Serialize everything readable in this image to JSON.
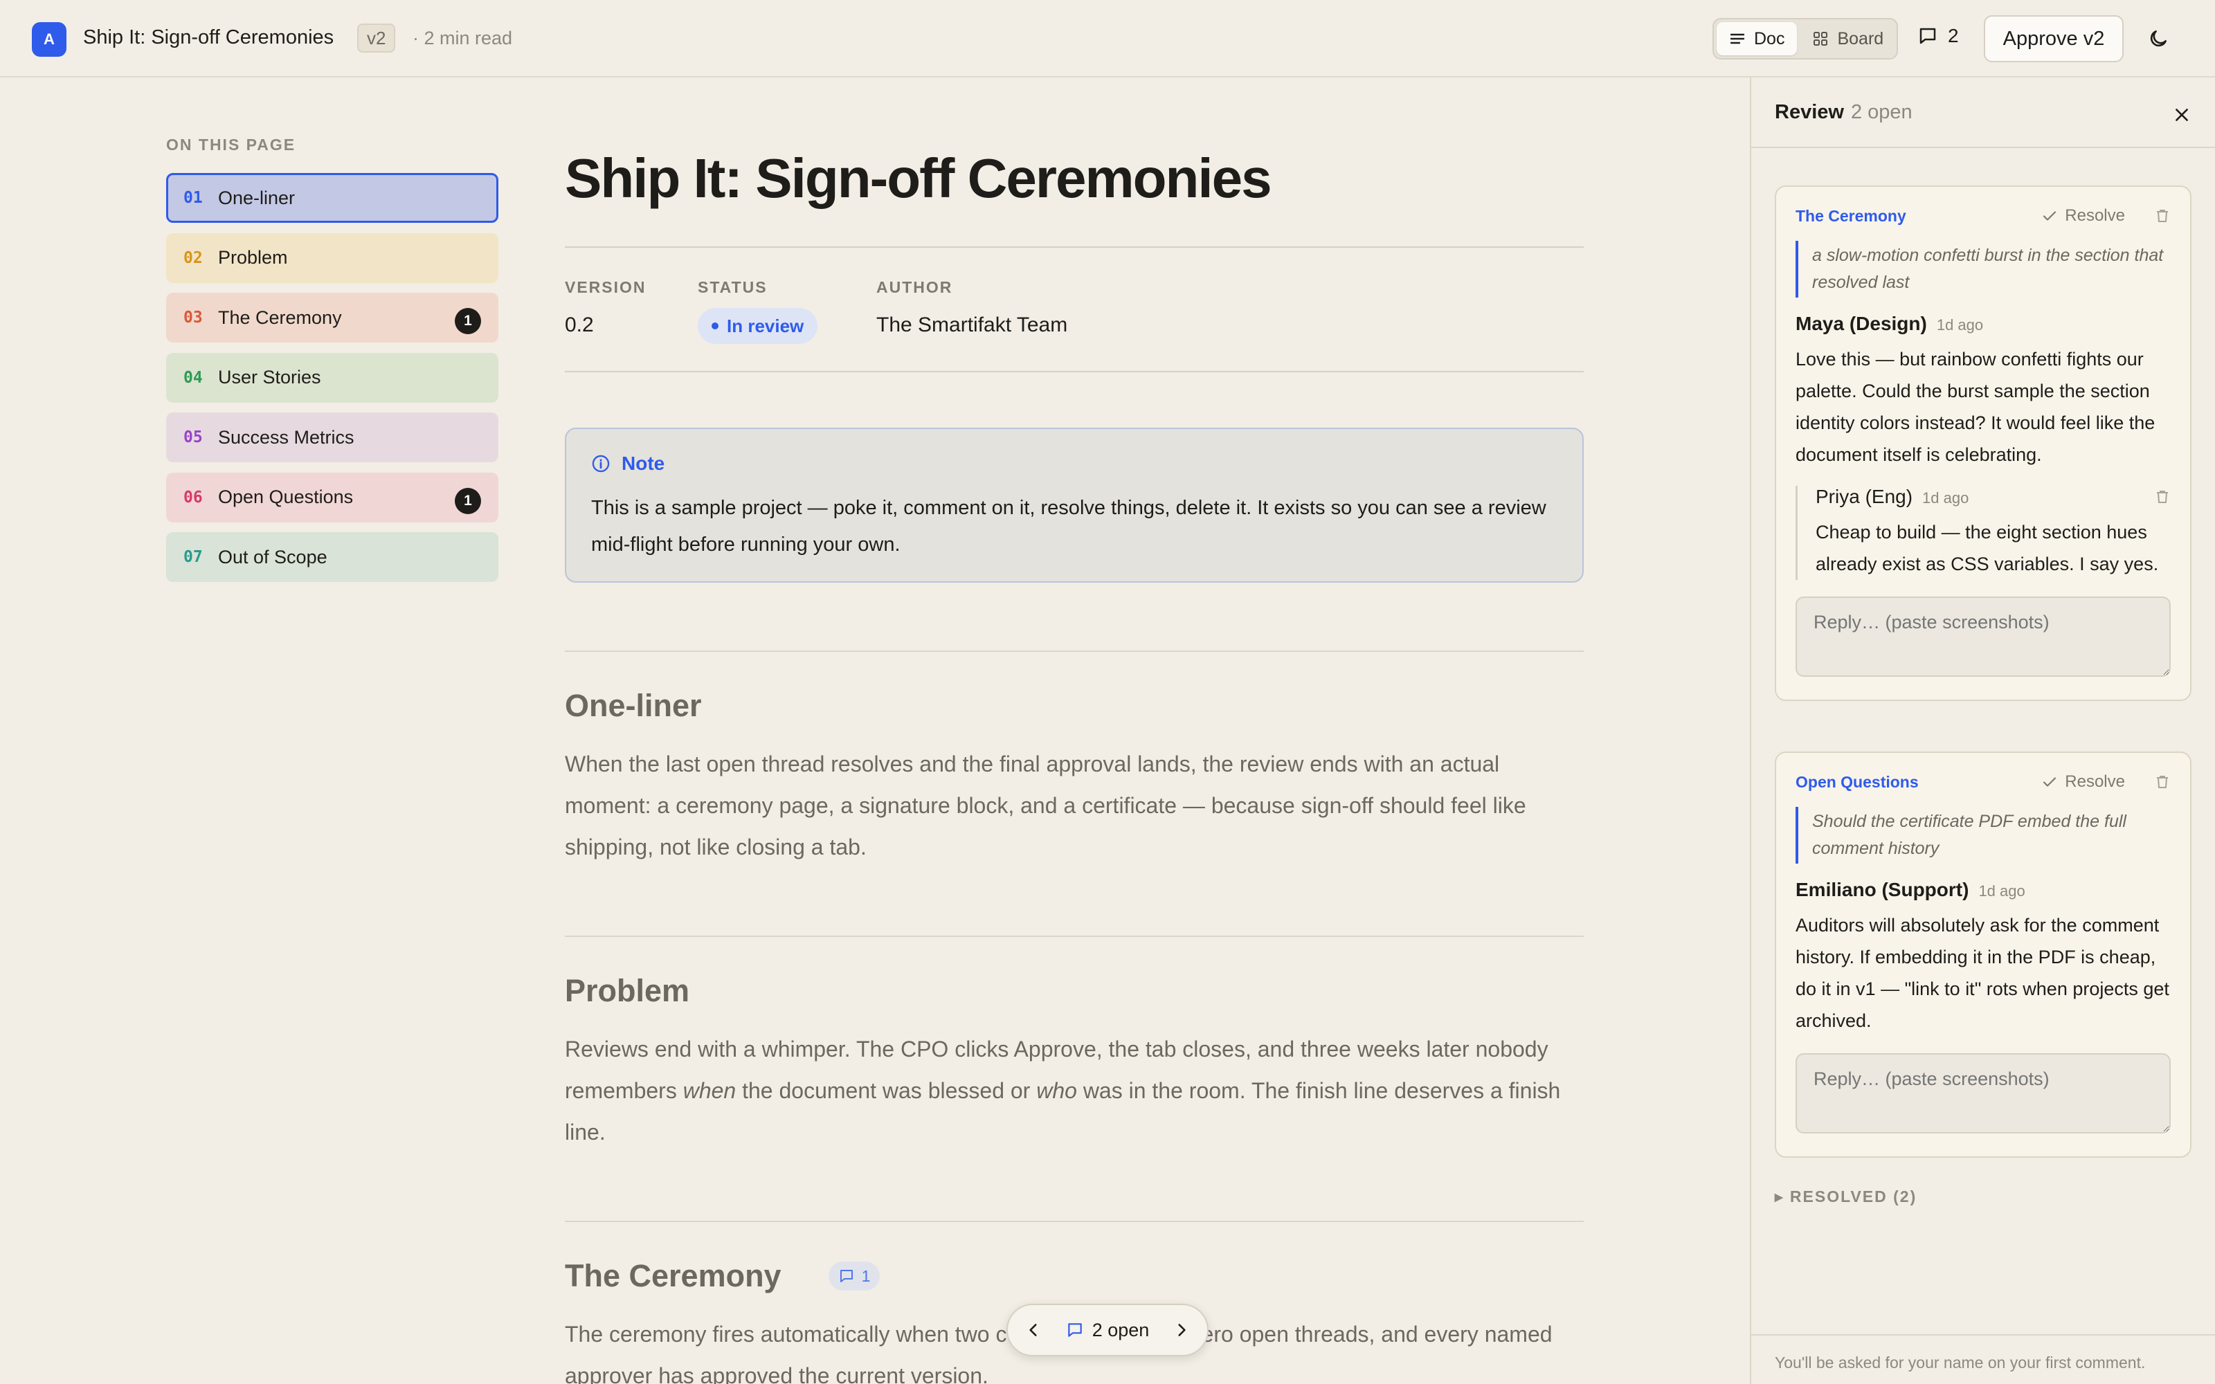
{
  "header": {
    "logo_letter": "A",
    "title": "Ship It: Sign-off Ceremonies",
    "version_badge": "v2",
    "read_time": "· 2 min read",
    "view_doc": "Doc",
    "view_board": "Board",
    "comments_count": "2",
    "approve_label": "Approve v2"
  },
  "toc": {
    "heading": "ON THIS PAGE",
    "items": [
      {
        "num": "01",
        "label": "One-liner",
        "badge": "",
        "color": "#2f5bea",
        "bg": "#c3c8e4"
      },
      {
        "num": "02",
        "label": "Problem",
        "badge": "",
        "color": "#d9951a",
        "bg": "#f2e4c6"
      },
      {
        "num": "03",
        "label": "The Ceremony",
        "badge": "1",
        "color": "#d9583a",
        "bg": "#f0d9cc"
      },
      {
        "num": "04",
        "label": "User Stories",
        "badge": "",
        "color": "#2f9a55",
        "bg": "#dbe4cf"
      },
      {
        "num": "05",
        "label": "Success Metrics",
        "badge": "",
        "color": "#9a44c9",
        "bg": "#e6dae0"
      },
      {
        "num": "06",
        "label": "Open Questions",
        "badge": "1",
        "color": "#d83a6a",
        "bg": "#f0d7d5"
      },
      {
        "num": "07",
        "label": "Out of Scope",
        "badge": "",
        "color": "#2a9a8f",
        "bg": "#d9e3d7"
      }
    ]
  },
  "doc": {
    "title": "Ship It: Sign-off Ceremonies",
    "meta": {
      "version_label": "VERSION",
      "version": "0.2",
      "status_label": "STATUS",
      "status": "In review",
      "author_label": "AUTHOR",
      "author": "The Smartifakt Team"
    },
    "note": {
      "label": "Note",
      "text": "This is a sample project — poke it, comment on it, resolve things, delete it. It exists so you can see a review mid-flight before running your own."
    },
    "sections": {
      "one_liner": {
        "title": "One-liner",
        "body": "When the last open thread resolves and the final approval lands, the review ends with an actual moment: a ceremony page, a signature block, and a certificate — because sign-off should feel like shipping, not like closing a tab."
      },
      "problem": {
        "title": "Problem",
        "body_a": "Reviews end with a whimper. The CPO clicks Approve, the tab closes, and three weeks later nobody remembers ",
        "em1": "when",
        "body_b": " the document was blessed or ",
        "em2": "who",
        "body_c": " was in the room. The finish line deserves a finish line."
      },
      "ceremony": {
        "title": "The Ceremony",
        "comment_badge": "1",
        "body": "The ceremony fires automatically when two conditions are true: zero open threads, and every named approver has approved the current version."
      }
    },
    "pager": "2 open"
  },
  "review": {
    "title": "Review",
    "open_count": "2 open",
    "threads": [
      {
        "section": "The Ceremony",
        "resolve_label": "Resolve",
        "quote": "a slow-motion confetti burst in the section that resolved last",
        "author": "Maya (Design)",
        "time": "1d ago",
        "text": "Love this — but rainbow confetti fights our palette. Could the burst sample the section identity colors instead? It would feel like the document itself is celebrating.",
        "reply": {
          "author": "Priya (Eng)",
          "time": "1d ago",
          "text": "Cheap to build — the eight section hues already exist as CSS variables. I say yes."
        },
        "reply_placeholder": "Reply… (paste screenshots)"
      },
      {
        "section": "Open Questions",
        "resolve_label": "Resolve",
        "quote": "Should the certificate PDF embed the full comment history",
        "author": "Emiliano (Support)",
        "time": "1d ago",
        "text": "Auditors will absolutely ask for the comment history. If embedding it in the PDF is cheap, do it in v1 — \"link to it\" rots when projects get archived.",
        "reply_placeholder": "Reply… (paste screenshots)"
      }
    ],
    "resolved_label": "▸ RESOLVED (2)",
    "footer": "You'll be asked for your name on your first comment."
  }
}
